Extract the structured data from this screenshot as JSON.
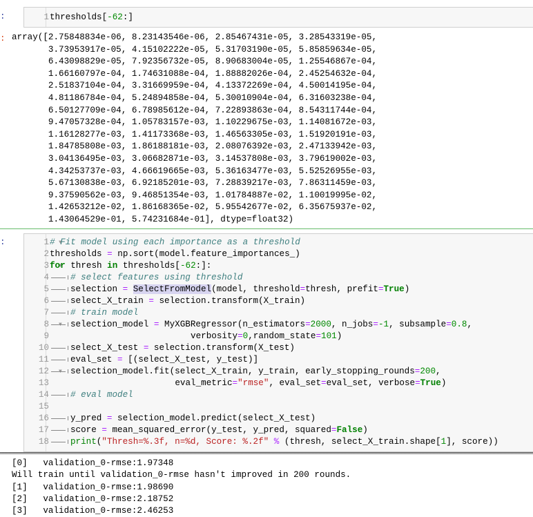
{
  "cell1": {
    "in_prompt": ":",
    "out_prompt": ":",
    "lines": [
      {
        "n": "1",
        "fold": false,
        "tokens": [
          [
            "plain",
            "thresholds["
          ],
          [
            "num",
            "-62"
          ],
          [
            "plain",
            ":]"
          ]
        ]
      }
    ],
    "output": [
      "array([2.75848834e-06, 8.23143546e-06, 2.85467431e-05, 3.28543319e-05,",
      "       3.73953917e-05, 4.15102222e-05, 5.31703190e-05, 5.85859634e-05,",
      "       6.43098829e-05, 7.92356732e-05, 8.90683004e-05, 1.25546867e-04,",
      "       1.66160797e-04, 1.74631088e-04, 1.88882026e-04, 2.45254632e-04,",
      "       2.51837104e-04, 3.31669959e-04, 4.13372269e-04, 4.50014195e-04,",
      "       4.81186784e-04, 5.24894858e-04, 5.30010904e-04, 6.31603238e-04,",
      "       6.50127709e-04, 6.78985612e-04, 7.22893863e-04, 8.54311744e-04,",
      "       9.47057328e-04, 1.05783157e-03, 1.10229675e-03, 1.14081672e-03,",
      "       1.16128277e-03, 1.41173368e-03, 1.46563305e-03, 1.51920191e-03,",
      "       1.84785808e-03, 1.86188181e-03, 2.08076392e-03, 2.47133942e-03,",
      "       3.04136495e-03, 3.06682871e-03, 3.14537808e-03, 3.79619002e-03,",
      "       4.34253737e-03, 4.66619665e-03, 5.36163477e-03, 5.52526955e-03,",
      "       5.67130838e-03, 6.92185201e-03, 7.28839217e-03, 7.86311459e-03,",
      "       9.37590562e-03, 9.46851354e-03, 1.01784887e-02, 1.10019995e-02,",
      "       1.42653212e-02, 1.86168365e-02, 5.95542677e-02, 6.35675937e-02,",
      "       1.43064529e-01, 5.74231684e-01], dtype=float32)"
    ]
  },
  "cell2": {
    "in_prompt": ":",
    "lines": [
      {
        "n": "1",
        "fold": true,
        "tab": false,
        "tokens": [
          [
            "comment",
            "# Fit model using each importance as a threshold"
          ]
        ]
      },
      {
        "n": "2",
        "fold": false,
        "tab": false,
        "tokens": [
          [
            "plain",
            "thresholds "
          ],
          [
            "op",
            "="
          ],
          [
            "plain",
            " np.sort(model.feature_importances_)"
          ]
        ]
      },
      {
        "n": "3",
        "fold": true,
        "tab": false,
        "tokens": [
          [
            "kw",
            "for"
          ],
          [
            "plain",
            " thresh "
          ],
          [
            "kw",
            "in"
          ],
          [
            "plain",
            " thresholds["
          ],
          [
            "num",
            "-62"
          ],
          [
            "plain",
            ":]:"
          ]
        ]
      },
      {
        "n": "4",
        "fold": false,
        "tab": true,
        "tokens": [
          [
            "comment",
            "# select features using threshold"
          ]
        ]
      },
      {
        "n": "5",
        "fold": false,
        "tab": true,
        "tokens": [
          [
            "plain",
            "selection "
          ],
          [
            "op",
            "="
          ],
          [
            "plain",
            " "
          ],
          [
            "hl",
            "SelectFromModel"
          ],
          [
            "plain",
            "(model, threshold"
          ],
          [
            "op",
            "="
          ],
          [
            "plain",
            "thresh, prefit"
          ],
          [
            "op",
            "="
          ],
          [
            "kw",
            "True"
          ],
          [
            "plain",
            ")"
          ]
        ]
      },
      {
        "n": "6",
        "fold": false,
        "tab": true,
        "tokens": [
          [
            "plain",
            "select_X_train "
          ],
          [
            "op",
            "="
          ],
          [
            "plain",
            " selection.transform(X_train)"
          ]
        ]
      },
      {
        "n": "7",
        "fold": false,
        "tab": true,
        "tokens": [
          [
            "comment",
            "# train model"
          ]
        ]
      },
      {
        "n": "8",
        "fold": true,
        "tab": true,
        "tokens": [
          [
            "plain",
            "selection_model "
          ],
          [
            "op",
            "="
          ],
          [
            "plain",
            " MyXGBRegressor(n_estimators"
          ],
          [
            "op",
            "="
          ],
          [
            "num",
            "2000"
          ],
          [
            "plain",
            ", n_jobs"
          ],
          [
            "op",
            "="
          ],
          [
            "num",
            "-1"
          ],
          [
            "plain",
            ", subsample"
          ],
          [
            "op",
            "="
          ],
          [
            "num",
            "0.8"
          ],
          [
            "plain",
            ","
          ]
        ]
      },
      {
        "n": "9",
        "fold": false,
        "tab": false,
        "tokens": [
          [
            "plain",
            "                           verbosity"
          ],
          [
            "op",
            "="
          ],
          [
            "num",
            "0"
          ],
          [
            "plain",
            ",random_state"
          ],
          [
            "op",
            "="
          ],
          [
            "num",
            "101"
          ],
          [
            "plain",
            ")"
          ]
        ]
      },
      {
        "n": "10",
        "fold": false,
        "tab": true,
        "tokens": [
          [
            "plain",
            "select_X_test "
          ],
          [
            "op",
            "="
          ],
          [
            "plain",
            " selection.transform(X_test)"
          ]
        ]
      },
      {
        "n": "11",
        "fold": false,
        "tab": true,
        "tokens": [
          [
            "plain",
            "eval_set "
          ],
          [
            "op",
            "="
          ],
          [
            "plain",
            " [(select_X_test, y_test)]"
          ]
        ]
      },
      {
        "n": "12",
        "fold": true,
        "tab": true,
        "tokens": [
          [
            "plain",
            "selection_model.fit(select_X_train, y_train, early_stopping_rounds"
          ],
          [
            "op",
            "="
          ],
          [
            "num",
            "200"
          ],
          [
            "plain",
            ","
          ]
        ]
      },
      {
        "n": "13",
        "fold": false,
        "tab": false,
        "tokens": [
          [
            "plain",
            "                        eval_metric"
          ],
          [
            "op",
            "="
          ],
          [
            "str",
            "\"rmse\""
          ],
          [
            "plain",
            ", eval_set"
          ],
          [
            "op",
            "="
          ],
          [
            "plain",
            "eval_set, verbose"
          ],
          [
            "op",
            "="
          ],
          [
            "kw",
            "True"
          ],
          [
            "plain",
            ")"
          ]
        ]
      },
      {
        "n": "14",
        "fold": false,
        "tab": true,
        "tokens": [
          [
            "comment",
            "# eval model"
          ]
        ]
      },
      {
        "n": "15",
        "fold": false,
        "tab": false,
        "tokens": []
      },
      {
        "n": "16",
        "fold": false,
        "tab": true,
        "tokens": [
          [
            "plain",
            "y_pred "
          ],
          [
            "op",
            "="
          ],
          [
            "plain",
            " selection_model.predict(select_X_test)"
          ]
        ]
      },
      {
        "n": "17",
        "fold": false,
        "tab": true,
        "tokens": [
          [
            "plain",
            "score "
          ],
          [
            "op",
            "="
          ],
          [
            "plain",
            " mean_squared_error(y_test, y_pred, squared"
          ],
          [
            "op",
            "="
          ],
          [
            "kw",
            "False"
          ],
          [
            "plain",
            ")"
          ]
        ]
      },
      {
        "n": "18",
        "fold": false,
        "tab": true,
        "tokens": [
          [
            "builtin",
            "print"
          ],
          [
            "plain",
            "("
          ],
          [
            "str",
            "\"Thresh=%.3f, n=%d, Score: %.2f\""
          ],
          [
            "plain",
            " "
          ],
          [
            "op",
            "%"
          ],
          [
            "plain",
            " (thresh, select_X_train.shape["
          ],
          [
            "num",
            "1"
          ],
          [
            "plain",
            "], score))"
          ]
        ]
      }
    ],
    "output": [
      "[0]\tvalidation_0-rmse:1.97348",
      "Will train until validation_0-rmse hasn't improved in 200 rounds.",
      "[1]\tvalidation_0-rmse:1.98690",
      "[2]\tvalidation_0-rmse:2.18752",
      "[3]\tvalidation_0-rmse:2.46253"
    ]
  }
}
